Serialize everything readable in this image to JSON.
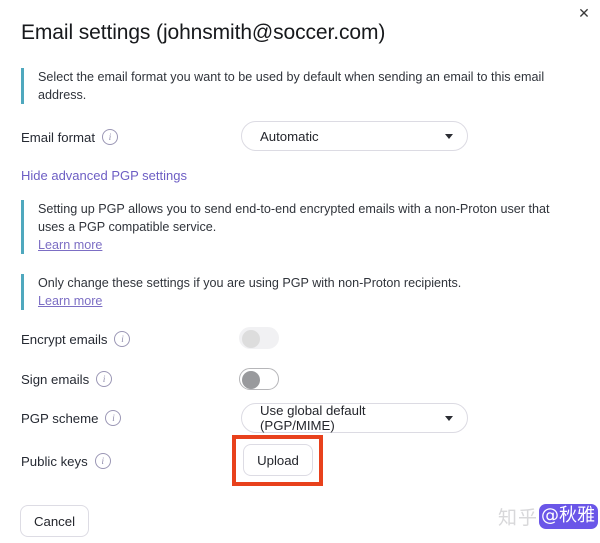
{
  "window": {
    "title": "Email settings (johnsmith@soccer.com)",
    "close_icon": "close-icon",
    "close_glyph": "✕"
  },
  "notes": [
    {
      "id": "email-format",
      "text": "Select the email format you want to be used by default when sending an email to this email address.",
      "link": null
    },
    {
      "id": "pgp-setup",
      "text": "Setting up PGP allows you to send end-to-end encrypted emails with a non-Proton user that uses a PGP compatible service.",
      "link": "Learn more"
    },
    {
      "id": "pgp-warning",
      "text": "Only change these settings if you are using PGP with non-Proton recipients.",
      "link": "Learn more"
    }
  ],
  "fields": {
    "email_format": {
      "label": "Email format",
      "info_icon": "info-icon",
      "selected": "Automatic",
      "options": [
        "Automatic"
      ]
    },
    "encrypt_emails": {
      "label": "Encrypt emails",
      "info_icon": "info-icon",
      "state": "off",
      "disabled": true
    },
    "sign_emails": {
      "label": "Sign emails",
      "info_icon": "info-icon",
      "state": "off",
      "disabled": false
    },
    "pgp_scheme": {
      "label": "PGP scheme",
      "info_icon": "info-icon",
      "selected": "Use global default (PGP/MIME)",
      "options": [
        "Use global default (PGP/MIME)"
      ]
    },
    "public_keys": {
      "label": "Public keys",
      "info_icon": "info-icon",
      "upload_label": "Upload"
    }
  },
  "links": {
    "hide_advanced": "Hide advanced PGP settings"
  },
  "footer": {
    "cancel_label": "Cancel"
  },
  "annotation": {
    "highlight_color": "#e8411c",
    "target": "upload-button"
  },
  "watermark": {
    "site": "知乎",
    "handle": "@秋雅",
    "badge_color": "#6a56e8"
  },
  "colors": {
    "accent_bar": "#4fa8be",
    "link_purple": "#6d5ec4",
    "text": "#262a33"
  }
}
